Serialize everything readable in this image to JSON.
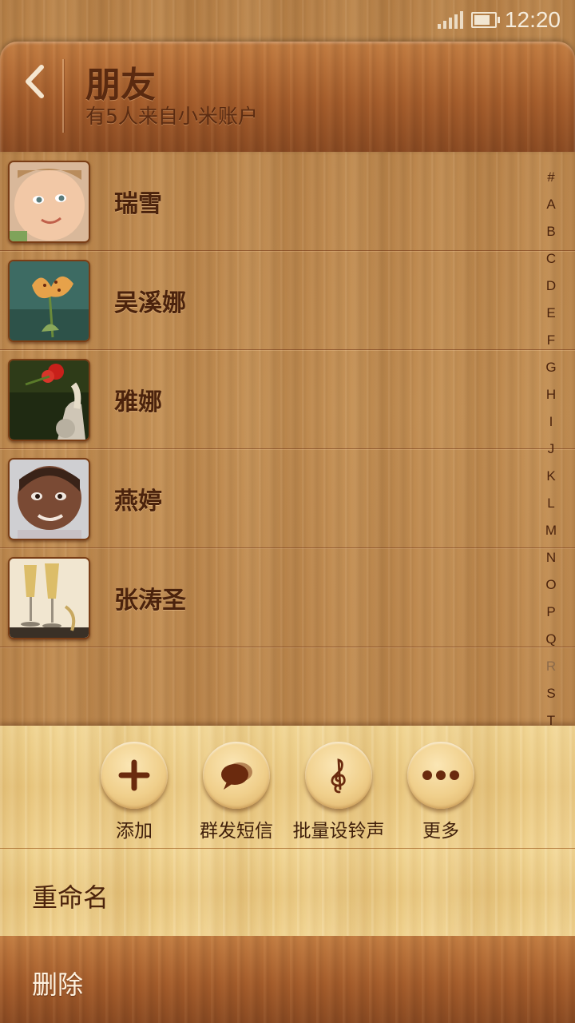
{
  "status_bar": {
    "time": "12:20",
    "signal_icon": "signal-icon",
    "battery_icon": "battery-icon",
    "battery_level": 0.8
  },
  "header": {
    "title": "朋友",
    "subtitle": "有5人来自小米账户",
    "back_icon": "chevron-left-icon"
  },
  "contacts": [
    {
      "name": "瑞雪",
      "avatar": "baby-photo"
    },
    {
      "name": "吴溪娜",
      "avatar": "lily-flower-photo"
    },
    {
      "name": "雅娜",
      "avatar": "cat-and-flower-photo"
    },
    {
      "name": "燕婷",
      "avatar": "child-portrait-photo"
    },
    {
      "name": "张涛圣",
      "avatar": "champagne-glasses-photo"
    }
  ],
  "alphabet_index": [
    "#",
    "A",
    "B",
    "C",
    "D",
    "E",
    "F",
    "G",
    "H",
    "I",
    "J",
    "K",
    "L",
    "M",
    "N",
    "O",
    "P",
    "Q",
    "R",
    "S",
    "T"
  ],
  "alphabet_index_dimmed": "R",
  "actions": [
    {
      "label": "添加",
      "icon": "plus-icon"
    },
    {
      "label": "群发短信",
      "icon": "speech-bubble-icon"
    },
    {
      "label": "批量设铃声",
      "icon": "treble-clef-icon"
    },
    {
      "label": "更多",
      "icon": "more-dots-icon"
    }
  ],
  "menu": {
    "rename": "重命名",
    "delete": "删除"
  },
  "colors": {
    "dark_text": "#4b230d",
    "header_title": "#5a2a10",
    "delete_text": "#fff3e0"
  }
}
